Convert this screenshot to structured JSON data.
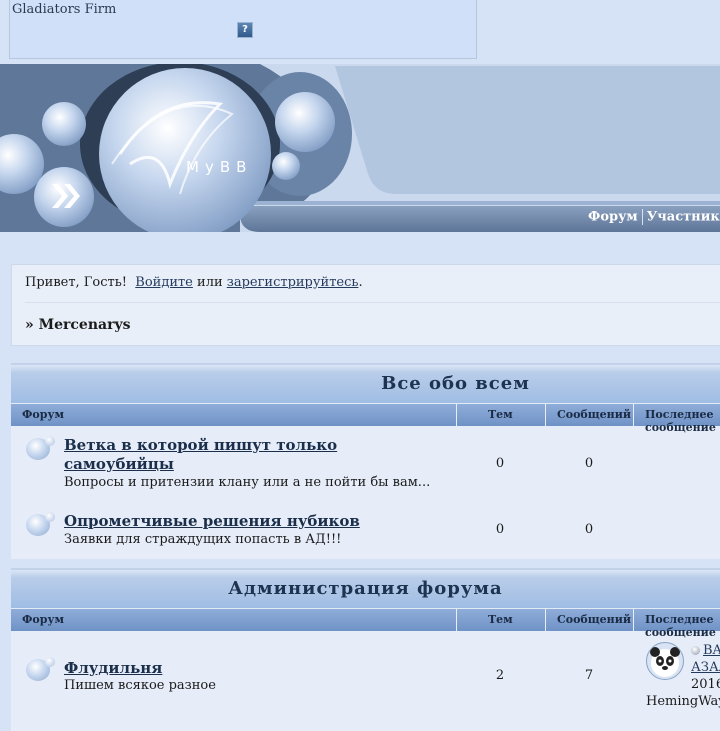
{
  "ad": {
    "title": "Gladiators Firm",
    "help_icon": "?"
  },
  "banner": {
    "logo_text": "MyBB"
  },
  "topnav": {
    "items": [
      "Форум",
      "Участники"
    ]
  },
  "welcome": {
    "greeting": "Привет, Гость!",
    "login_link": "Войдите",
    "or": "или",
    "register_link": "зарегистрируйтесь",
    "dot": ".",
    "breadcrumb_marker": "»",
    "breadcrumb": "Mercenarys"
  },
  "columns": {
    "forum": "Форум",
    "topics": "Тем",
    "posts": "Сообщений",
    "last": "Последнее сообщение"
  },
  "categories": [
    {
      "title": "Все обо всем",
      "forums": [
        {
          "title_line1": "Ветка в которой пишут только",
          "title_line2": "самоубийцы",
          "desc": "Вопросы и притензии клану или а не пойти бы вам...",
          "topics": "0",
          "posts": "0"
        },
        {
          "title_line1": "Опрометчивые решения нубиков",
          "desc": "Заявки для страждущих попасть в АД!!!",
          "topics": "0",
          "posts": "0"
        }
      ]
    },
    {
      "title": "Администрация форума",
      "forums": [
        {
          "title_line1": "Флудильня",
          "desc": "Пишем всякое разное",
          "topics": "2",
          "posts": "7",
          "last_line1": "BA",
          "last_line2": "АЗАЛ",
          "last_line3": "2016",
          "last_author": "HemingWay"
        }
      ]
    }
  ],
  "colors": {
    "header_dark": "#5a7396",
    "accent": "#1d3350"
  }
}
